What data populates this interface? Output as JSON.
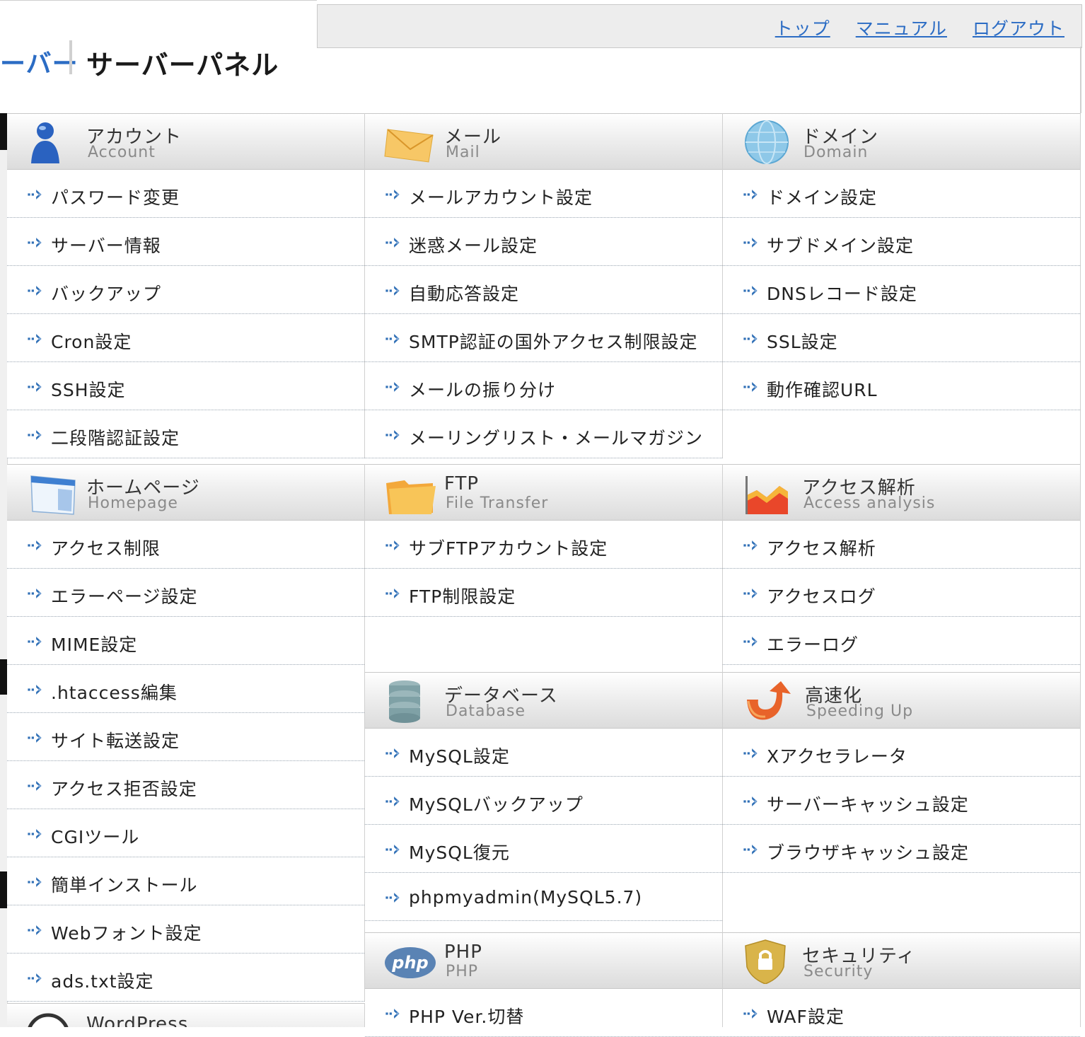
{
  "brand": {
    "name_partial": "ーバー",
    "title": "サーバーパネル"
  },
  "top_nav": [
    "トップ",
    "マニュアル",
    "ログアウト"
  ],
  "panels": {
    "account": {
      "jp": "アカウント",
      "en": "Account",
      "items": [
        "パスワード変更",
        "サーバー情報",
        "バックアップ",
        "Cron設定",
        "SSH設定",
        "二段階認証設定"
      ]
    },
    "mail": {
      "jp": "メール",
      "en": "Mail",
      "items": [
        "メールアカウント設定",
        "迷惑メール設定",
        "自動応答設定",
        "SMTP認証の国外アクセス制限設定",
        "メールの振り分け",
        "メーリングリスト・メールマガジン"
      ]
    },
    "domain": {
      "jp": "ドメイン",
      "en": "Domain",
      "items": [
        "ドメイン設定",
        "サブドメイン設定",
        "DNSレコード設定",
        "SSL設定",
        "動作確認URL"
      ]
    },
    "homepage": {
      "jp": "ホームページ",
      "en": "Homepage",
      "items": [
        "アクセス制限",
        "エラーページ設定",
        "MIME設定",
        ".htaccess編集",
        "サイト転送設定",
        "アクセス拒否設定",
        "CGIツール",
        "簡単インストール",
        "Webフォント設定",
        "ads.txt設定"
      ]
    },
    "ftp": {
      "jp": "FTP",
      "en": "File Transfer",
      "items": [
        "サブFTPアカウント設定",
        "FTP制限設定"
      ]
    },
    "access": {
      "jp": "アクセス解析",
      "en": "Access analysis",
      "items": [
        "アクセス解析",
        "アクセスログ",
        "エラーログ"
      ]
    },
    "database": {
      "jp": "データベース",
      "en": "Database",
      "items": [
        "MySQL設定",
        "MySQLバックアップ",
        "MySQL復元",
        "phpmyadmin(MySQL5.7)"
      ]
    },
    "speed": {
      "jp": "高速化",
      "en": "Speeding Up",
      "items": [
        "Xアクセラレータ",
        "サーバーキャッシュ設定",
        "ブラウザキャッシュ設定"
      ]
    },
    "php": {
      "jp": "PHP",
      "en": "PHP",
      "items": [
        "PHP Ver.切替"
      ]
    },
    "security": {
      "jp": "セキュリティ",
      "en": "Security",
      "items": [
        "WAF設定"
      ]
    },
    "wordpress": {
      "jp": "WordPress"
    }
  },
  "colors": {
    "link": "#2b6cc4",
    "header_gradient_end": "#dcdcdc",
    "divider": "#9aa6b2"
  },
  "icons": {
    "account": "user-icon",
    "mail": "envelope-icon",
    "domain": "globe-icon",
    "homepage": "browser-window-icon",
    "ftp": "folder-icon",
    "access": "chart-icon",
    "database": "database-icon",
    "speed": "arrow-icon",
    "php": "php-logo-icon",
    "security": "lock-shield-icon",
    "wordpress": "wordpress-icon",
    "item": "arrow-right-icon"
  }
}
